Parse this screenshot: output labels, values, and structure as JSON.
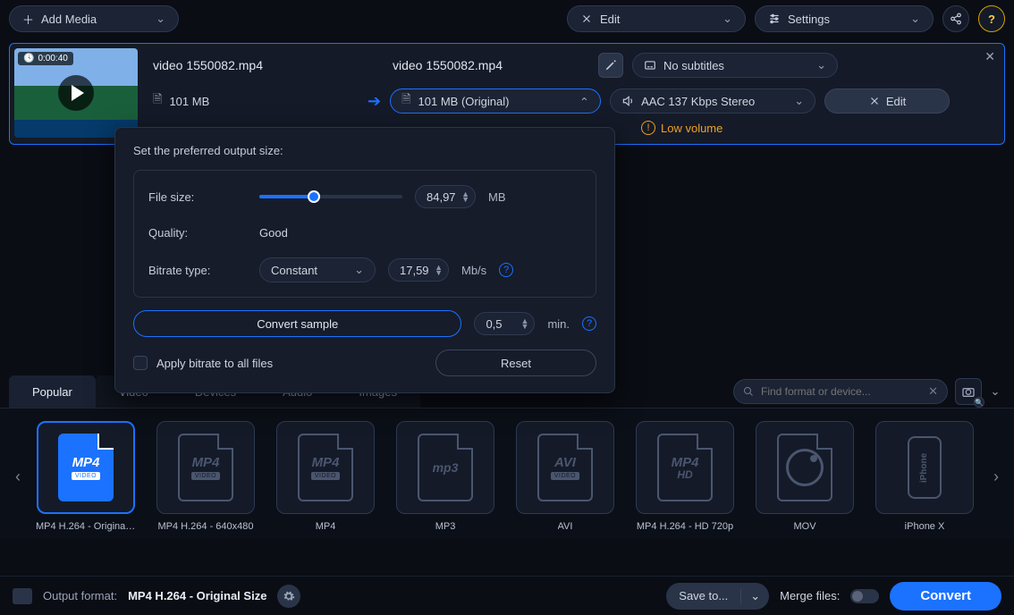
{
  "topbar": {
    "add_media": "Add Media",
    "edit": "Edit",
    "settings": "Settings"
  },
  "media": {
    "duration": "0:00:40",
    "source_name": "video 1550082.mp4",
    "target_name": "video 1550082.mp4",
    "source_size": "101 MB",
    "target_size": "101 MB (Original)",
    "subtitles": "No subtitles",
    "audio": "AAC 137 Kbps Stereo",
    "edit_btn": "Edit",
    "warning": "Low volume"
  },
  "popover": {
    "heading": "Set the preferred output size:",
    "file_size_label": "File size:",
    "file_size_value": "84,97",
    "file_size_unit": "MB",
    "quality_label": "Quality:",
    "quality_value": "Good",
    "bitrate_label": "Bitrate type:",
    "bitrate_type": "Constant",
    "bitrate_value": "17,59",
    "bitrate_unit": "Mb/s",
    "convert_sample": "Convert sample",
    "sample_value": "0,5",
    "sample_unit": "min.",
    "apply_all": "Apply bitrate to all files",
    "reset": "Reset"
  },
  "tabs": [
    "Popular",
    "Video",
    "Devices",
    "Audio",
    "Images"
  ],
  "search_placeholder": "Find format or device...",
  "formats": [
    {
      "badge": "MP4",
      "sub": "VIDEO",
      "caption": "MP4 H.264 - Original ..."
    },
    {
      "badge": "MP4",
      "sub": "VIDEO",
      "caption": "MP4 H.264 - 640x480"
    },
    {
      "badge": "MP4",
      "sub": "VIDEO",
      "caption": "MP4"
    },
    {
      "badge": "mp3",
      "sub": "",
      "caption": "MP3"
    },
    {
      "badge": "AVI",
      "sub": "VIDEO",
      "caption": "AVI"
    },
    {
      "badge": "MP4",
      "sub": "HD",
      "caption": "MP4 H.264 - HD 720p"
    },
    {
      "badge": "QT",
      "sub": "",
      "caption": "MOV"
    },
    {
      "badge": "iPhone",
      "sub": "",
      "caption": "iPhone X"
    }
  ],
  "bottom": {
    "output_label": "Output format:",
    "output_value": "MP4 H.264 - Original Size",
    "save_to": "Save to...",
    "merge": "Merge files:",
    "convert": "Convert"
  }
}
